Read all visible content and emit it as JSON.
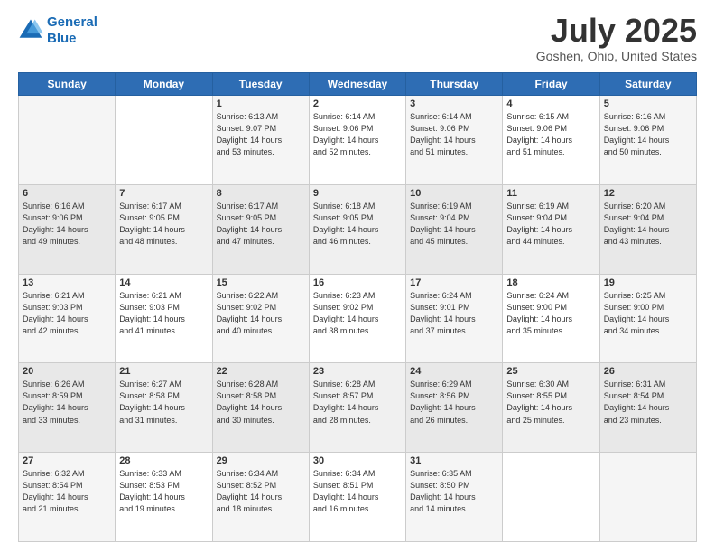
{
  "header": {
    "logo_line1": "General",
    "logo_line2": "Blue",
    "month": "July 2025",
    "location": "Goshen, Ohio, United States"
  },
  "weekdays": [
    "Sunday",
    "Monday",
    "Tuesday",
    "Wednesday",
    "Thursday",
    "Friday",
    "Saturday"
  ],
  "weeks": [
    [
      {
        "day": "",
        "sunrise": "",
        "sunset": "",
        "daylight": ""
      },
      {
        "day": "",
        "sunrise": "",
        "sunset": "",
        "daylight": ""
      },
      {
        "day": "1",
        "sunrise": "Sunrise: 6:13 AM",
        "sunset": "Sunset: 9:07 PM",
        "daylight": "Daylight: 14 hours and 53 minutes."
      },
      {
        "day": "2",
        "sunrise": "Sunrise: 6:14 AM",
        "sunset": "Sunset: 9:06 PM",
        "daylight": "Daylight: 14 hours and 52 minutes."
      },
      {
        "day": "3",
        "sunrise": "Sunrise: 6:14 AM",
        "sunset": "Sunset: 9:06 PM",
        "daylight": "Daylight: 14 hours and 51 minutes."
      },
      {
        "day": "4",
        "sunrise": "Sunrise: 6:15 AM",
        "sunset": "Sunset: 9:06 PM",
        "daylight": "Daylight: 14 hours and 51 minutes."
      },
      {
        "day": "5",
        "sunrise": "Sunrise: 6:16 AM",
        "sunset": "Sunset: 9:06 PM",
        "daylight": "Daylight: 14 hours and 50 minutes."
      }
    ],
    [
      {
        "day": "6",
        "sunrise": "Sunrise: 6:16 AM",
        "sunset": "Sunset: 9:06 PM",
        "daylight": "Daylight: 14 hours and 49 minutes."
      },
      {
        "day": "7",
        "sunrise": "Sunrise: 6:17 AM",
        "sunset": "Sunset: 9:05 PM",
        "daylight": "Daylight: 14 hours and 48 minutes."
      },
      {
        "day": "8",
        "sunrise": "Sunrise: 6:17 AM",
        "sunset": "Sunset: 9:05 PM",
        "daylight": "Daylight: 14 hours and 47 minutes."
      },
      {
        "day": "9",
        "sunrise": "Sunrise: 6:18 AM",
        "sunset": "Sunset: 9:05 PM",
        "daylight": "Daylight: 14 hours and 46 minutes."
      },
      {
        "day": "10",
        "sunrise": "Sunrise: 6:19 AM",
        "sunset": "Sunset: 9:04 PM",
        "daylight": "Daylight: 14 hours and 45 minutes."
      },
      {
        "day": "11",
        "sunrise": "Sunrise: 6:19 AM",
        "sunset": "Sunset: 9:04 PM",
        "daylight": "Daylight: 14 hours and 44 minutes."
      },
      {
        "day": "12",
        "sunrise": "Sunrise: 6:20 AM",
        "sunset": "Sunset: 9:04 PM",
        "daylight": "Daylight: 14 hours and 43 minutes."
      }
    ],
    [
      {
        "day": "13",
        "sunrise": "Sunrise: 6:21 AM",
        "sunset": "Sunset: 9:03 PM",
        "daylight": "Daylight: 14 hours and 42 minutes."
      },
      {
        "day": "14",
        "sunrise": "Sunrise: 6:21 AM",
        "sunset": "Sunset: 9:03 PM",
        "daylight": "Daylight: 14 hours and 41 minutes."
      },
      {
        "day": "15",
        "sunrise": "Sunrise: 6:22 AM",
        "sunset": "Sunset: 9:02 PM",
        "daylight": "Daylight: 14 hours and 40 minutes."
      },
      {
        "day": "16",
        "sunrise": "Sunrise: 6:23 AM",
        "sunset": "Sunset: 9:02 PM",
        "daylight": "Daylight: 14 hours and 38 minutes."
      },
      {
        "day": "17",
        "sunrise": "Sunrise: 6:24 AM",
        "sunset": "Sunset: 9:01 PM",
        "daylight": "Daylight: 14 hours and 37 minutes."
      },
      {
        "day": "18",
        "sunrise": "Sunrise: 6:24 AM",
        "sunset": "Sunset: 9:00 PM",
        "daylight": "Daylight: 14 hours and 35 minutes."
      },
      {
        "day": "19",
        "sunrise": "Sunrise: 6:25 AM",
        "sunset": "Sunset: 9:00 PM",
        "daylight": "Daylight: 14 hours and 34 minutes."
      }
    ],
    [
      {
        "day": "20",
        "sunrise": "Sunrise: 6:26 AM",
        "sunset": "Sunset: 8:59 PM",
        "daylight": "Daylight: 14 hours and 33 minutes."
      },
      {
        "day": "21",
        "sunrise": "Sunrise: 6:27 AM",
        "sunset": "Sunset: 8:58 PM",
        "daylight": "Daylight: 14 hours and 31 minutes."
      },
      {
        "day": "22",
        "sunrise": "Sunrise: 6:28 AM",
        "sunset": "Sunset: 8:58 PM",
        "daylight": "Daylight: 14 hours and 30 minutes."
      },
      {
        "day": "23",
        "sunrise": "Sunrise: 6:28 AM",
        "sunset": "Sunset: 8:57 PM",
        "daylight": "Daylight: 14 hours and 28 minutes."
      },
      {
        "day": "24",
        "sunrise": "Sunrise: 6:29 AM",
        "sunset": "Sunset: 8:56 PM",
        "daylight": "Daylight: 14 hours and 26 minutes."
      },
      {
        "day": "25",
        "sunrise": "Sunrise: 6:30 AM",
        "sunset": "Sunset: 8:55 PM",
        "daylight": "Daylight: 14 hours and 25 minutes."
      },
      {
        "day": "26",
        "sunrise": "Sunrise: 6:31 AM",
        "sunset": "Sunset: 8:54 PM",
        "daylight": "Daylight: 14 hours and 23 minutes."
      }
    ],
    [
      {
        "day": "27",
        "sunrise": "Sunrise: 6:32 AM",
        "sunset": "Sunset: 8:54 PM",
        "daylight": "Daylight: 14 hours and 21 minutes."
      },
      {
        "day": "28",
        "sunrise": "Sunrise: 6:33 AM",
        "sunset": "Sunset: 8:53 PM",
        "daylight": "Daylight: 14 hours and 19 minutes."
      },
      {
        "day": "29",
        "sunrise": "Sunrise: 6:34 AM",
        "sunset": "Sunset: 8:52 PM",
        "daylight": "Daylight: 14 hours and 18 minutes."
      },
      {
        "day": "30",
        "sunrise": "Sunrise: 6:34 AM",
        "sunset": "Sunset: 8:51 PM",
        "daylight": "Daylight: 14 hours and 16 minutes."
      },
      {
        "day": "31",
        "sunrise": "Sunrise: 6:35 AM",
        "sunset": "Sunset: 8:50 PM",
        "daylight": "Daylight: 14 hours and 14 minutes."
      },
      {
        "day": "",
        "sunrise": "",
        "sunset": "",
        "daylight": ""
      },
      {
        "day": "",
        "sunrise": "",
        "sunset": "",
        "daylight": ""
      }
    ]
  ]
}
